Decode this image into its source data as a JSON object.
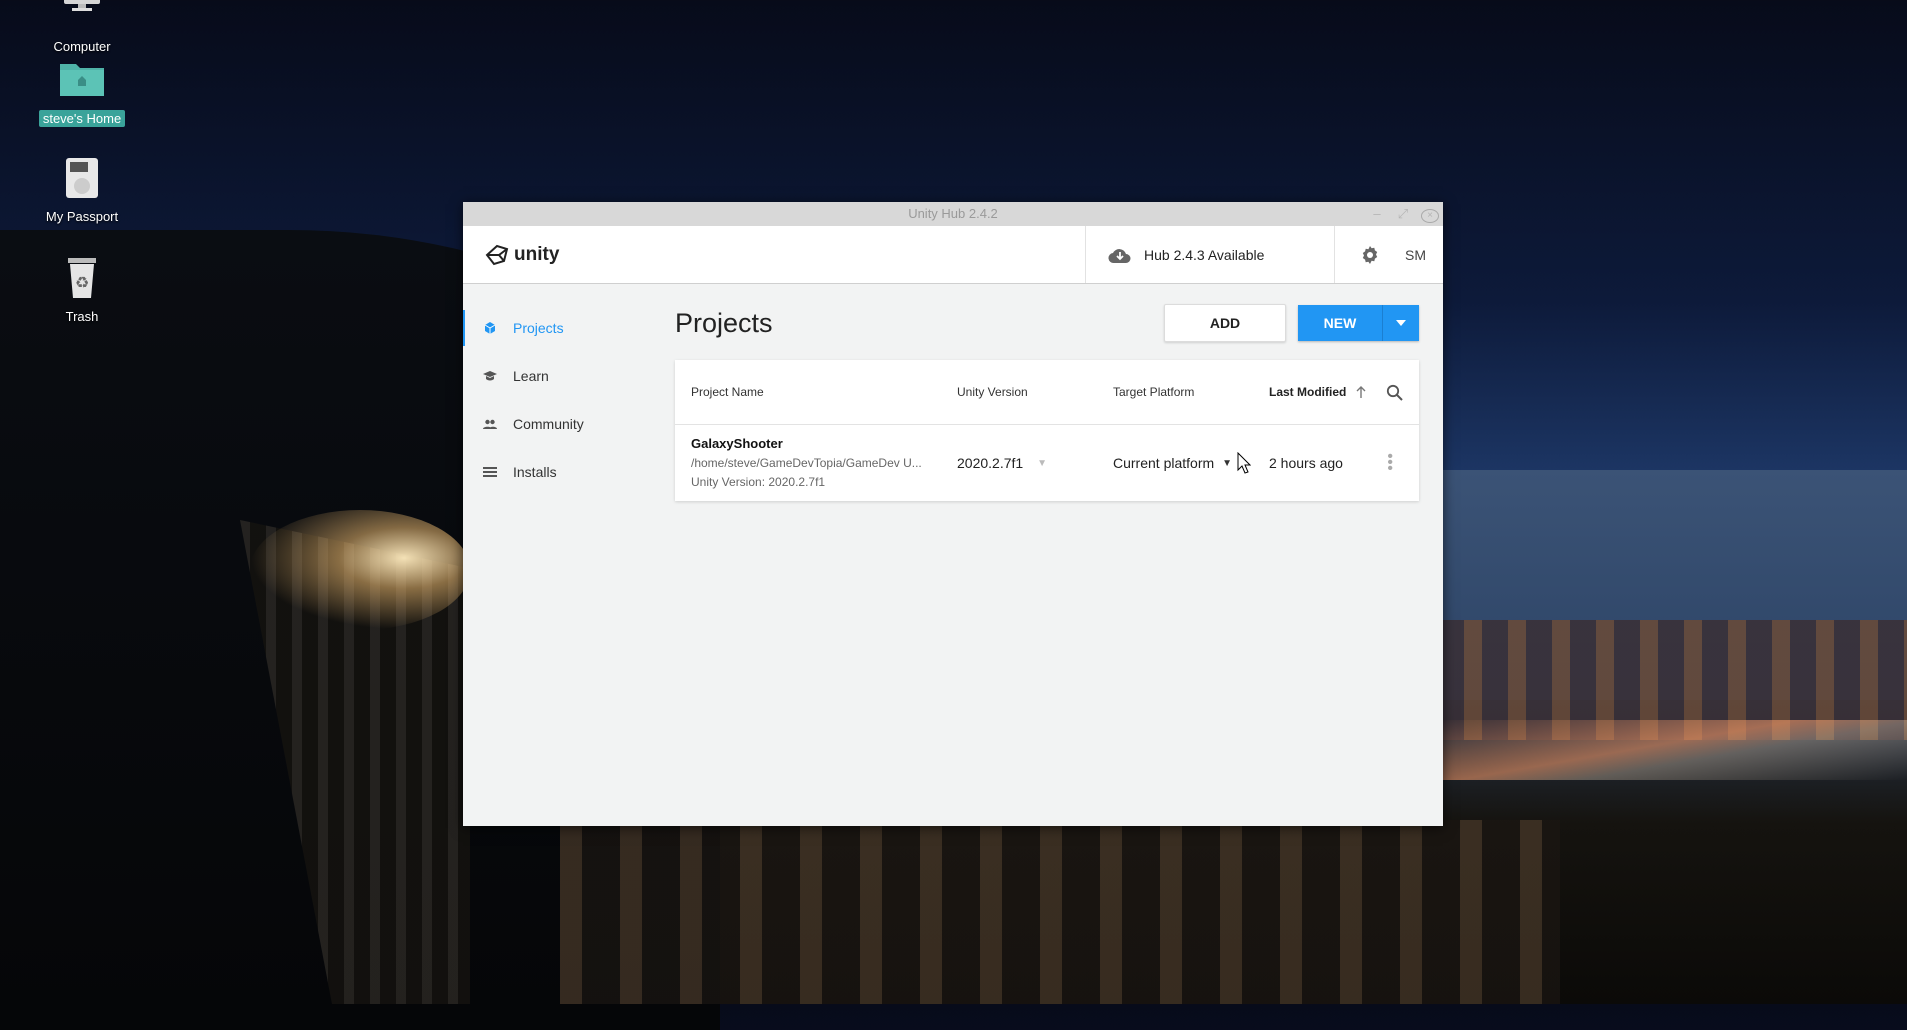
{
  "desktop": {
    "icons": [
      {
        "label": "Computer"
      },
      {
        "label": "steve's Home"
      },
      {
        "label": "My Passport"
      },
      {
        "label": "Trash"
      }
    ]
  },
  "window": {
    "title": "Unity Hub 2.4.2"
  },
  "appbar": {
    "logo_text": "unity",
    "update_text": "Hub 2.4.3 Available",
    "user_initials": "SM"
  },
  "sidebar": {
    "items": [
      {
        "label": "Projects",
        "icon": "cube-icon",
        "active": true
      },
      {
        "label": "Learn",
        "icon": "graduation-cap-icon",
        "active": false
      },
      {
        "label": "Community",
        "icon": "people-icon",
        "active": false
      },
      {
        "label": "Installs",
        "icon": "list-icon",
        "active": false
      }
    ]
  },
  "main": {
    "title": "Projects",
    "add_label": "ADD",
    "new_label": "NEW",
    "table": {
      "headers": {
        "name": "Project Name",
        "version": "Unity Version",
        "platform": "Target Platform",
        "modified": "Last Modified"
      },
      "rows": [
        {
          "name": "GalaxyShooter",
          "path": "/home/steve/GameDevTopia/GameDev U...",
          "unity_version_line": "Unity Version: 2020.2.7f1",
          "version": "2020.2.7f1",
          "platform": "Current platform",
          "modified": "2 hours ago"
        }
      ]
    }
  },
  "colors": {
    "accent": "#2196f3",
    "selection": "#3aa39a"
  }
}
